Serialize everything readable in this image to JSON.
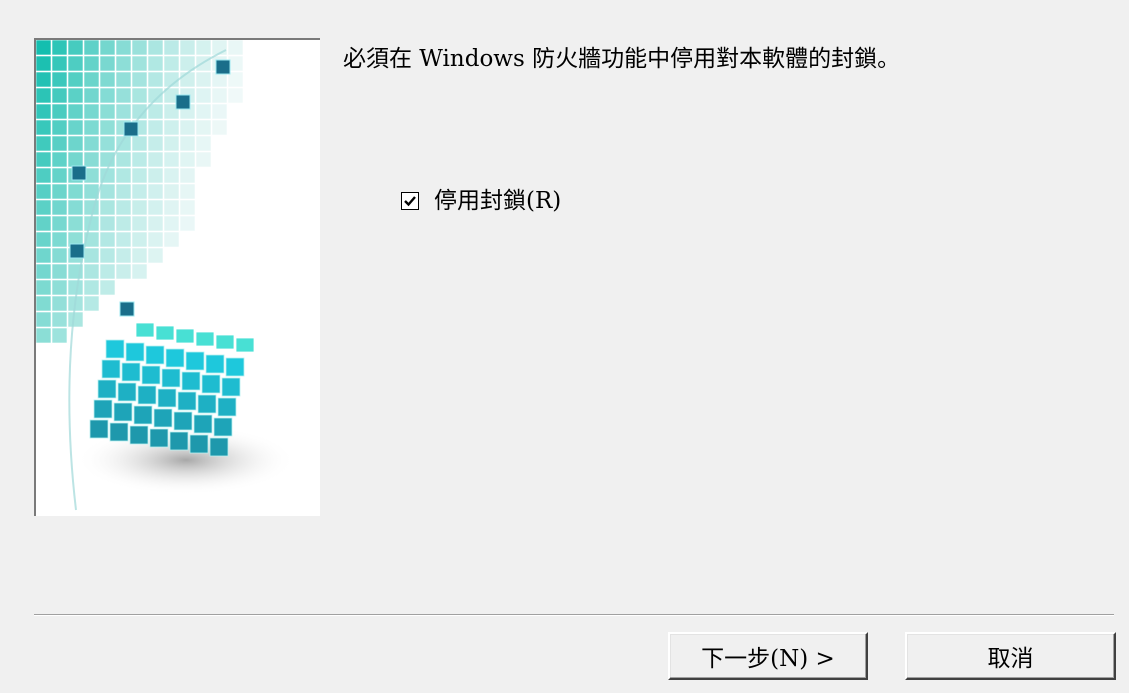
{
  "dialog": {
    "message": "必須在 Windows 防火牆功能中停用對本軟體的封鎖。",
    "checkbox": {
      "label": "停用封鎖(R)",
      "checked": true
    },
    "buttons": {
      "next_label": "下一步(N) >",
      "cancel_label": "取消"
    },
    "banner_icon": "cube-grid-illustration",
    "accent_color": "#20c8c8"
  }
}
